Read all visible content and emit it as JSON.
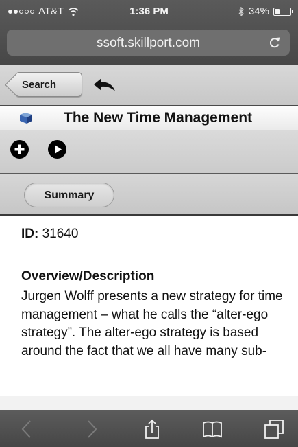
{
  "status_bar": {
    "carrier": "AT&T",
    "time": "1:36 PM",
    "battery": "34%",
    "battery_level": 0.34
  },
  "url_bar": {
    "url": "ssoft.skillport.com"
  },
  "nav": {
    "back_label": "Search",
    "title": "The New Time Management"
  },
  "tabs": {
    "summary_label": "Summary"
  },
  "content": {
    "id_label": "ID:",
    "id_value": "31640",
    "heading": "Overview/Description",
    "body": "Jurgen Wolff presents a new strategy for time management – what he calls the “alter-ego strategy”. The alter-ego strategy is based around the fact that we all have many sub-"
  },
  "colors": {
    "chrome_dark": "#4c4c4c",
    "nav_gray": "#cfcfcf",
    "text": "#111111"
  },
  "icons": {
    "reload": "reload-icon",
    "undo": "undo-arrow-icon",
    "book": "book-icon",
    "add": "add-circle-icon",
    "play": "play-circle-icon",
    "back": "chevron-left-icon",
    "forward": "chevron-right-icon",
    "share": "share-icon",
    "bookmarks": "bookmarks-icon",
    "tabs": "tabs-icon"
  }
}
